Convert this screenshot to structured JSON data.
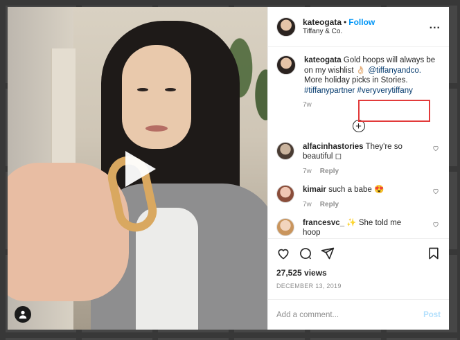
{
  "header": {
    "username": "kateogata",
    "separator": "•",
    "follow_label": "Follow",
    "location": "Tiffany & Co.",
    "more_label": "..."
  },
  "caption": {
    "username": "kateogata",
    "text_before": "Gold hoops will always be on my wishlist ",
    "emoji": "👌🏻",
    "mention": "@tiffanyandco.",
    "text_after": " More holiday picks in Stories.",
    "hashtag1": "#tiffanypartner",
    "hashtag2": "#veryverytiffany",
    "time": "7w"
  },
  "load_more_icon": "+",
  "comments": [
    {
      "username": "alfacinhastories",
      "text": "They're so beautiful ◻",
      "time": "7w",
      "reply_label": "Reply"
    },
    {
      "username": "kimair",
      "text": "such a babe 😍",
      "time": "7w",
      "reply_label": "Reply"
    },
    {
      "username": "francesvc_",
      "text": "✨ She told me hoop",
      "time": "",
      "reply_label": ""
    }
  ],
  "stats": {
    "views": "27,525 views",
    "date": "DECEMBER 13, 2019"
  },
  "add_comment": {
    "placeholder": "Add a comment...",
    "post_label": "Post"
  },
  "icons": [
    "heart-icon",
    "comment-icon",
    "share-icon",
    "bookmark-icon",
    "play-icon",
    "user-tag-icon",
    "more-icon",
    "plus-circle-icon"
  ],
  "colors": {
    "accent": "#0095f6",
    "highlight_box": "#e23a3a",
    "post_disabled": "#b2dffc"
  }
}
